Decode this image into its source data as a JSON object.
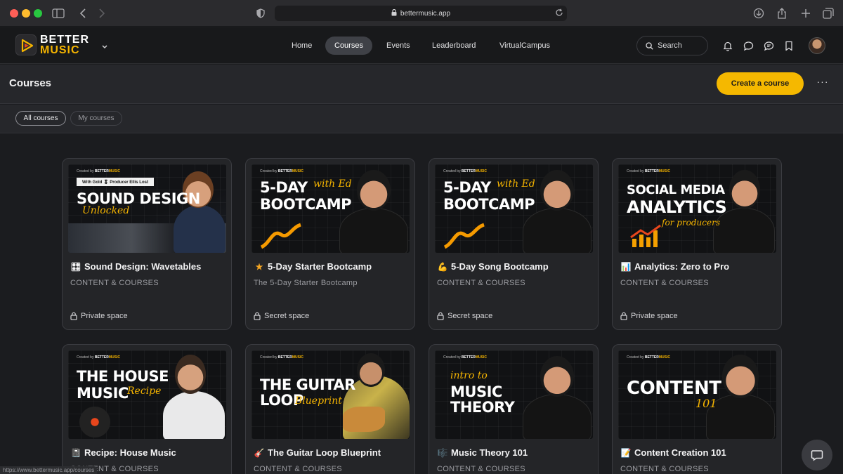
{
  "browser": {
    "url": "bettermusic.app",
    "status_url": "https://www.bettermusic.app/courses"
  },
  "brand": {
    "line1": "BETTER",
    "line2": "MUSIC"
  },
  "nav": {
    "items": [
      "Home",
      "Courses",
      "Events",
      "Leaderboard",
      "VirtualCampus"
    ],
    "active": "Courses"
  },
  "search": {
    "label": "Search"
  },
  "page": {
    "title": "Courses",
    "create_label": "Create a course",
    "more_label": "···"
  },
  "filters": {
    "all": "All courses",
    "mine": "My courses"
  },
  "thumb_brand": {
    "prefix": "Created by",
    "name1": "BETTER",
    "name2": "MUSIC"
  },
  "courses": [
    {
      "title": "Sound Design: Wavetables",
      "icon": "wave-emoji-icon",
      "glyph": "🎛",
      "subtitle": "CONTENT & COURSES",
      "space": "Private space",
      "thumb": {
        "banner": "With Gold 🎖 Producer Ellis Lost",
        "line1": "SOUND DESIGN",
        "script": "Unlocked"
      }
    },
    {
      "title": "5-Day Starter Bootcamp",
      "icon": "star-icon",
      "glyph": "★",
      "subtitle": "The 5-Day Starter Bootcamp",
      "space": "Secret space",
      "thumb": {
        "line1": "5-DAY",
        "script": "with Ed",
        "line2": "BOOTCAMP"
      }
    },
    {
      "title": "5-Day Song Bootcamp",
      "icon": "muscle-icon",
      "glyph": "💪",
      "subtitle": "CONTENT & COURSES",
      "space": "Secret space",
      "thumb": {
        "line1": "5-DAY",
        "script": "with Ed",
        "line2": "BOOTCAMP"
      }
    },
    {
      "title": "Analytics: Zero to Pro",
      "icon": "chart-icon",
      "glyph": "📊",
      "subtitle": "CONTENT & COURSES",
      "space": "Private space",
      "thumb": {
        "line1": "SOCIAL MEDIA",
        "line2": "ANALYTICS",
        "script": "for producers"
      }
    },
    {
      "title": "Recipe: House Music",
      "icon": "recipe-icon",
      "glyph": "📓",
      "subtitle": "CONTENT & COURSES",
      "space": "",
      "thumb": {
        "line1": "THE HOUSE",
        "line2": "MUSIC",
        "script": "Recipe"
      }
    },
    {
      "title": "The Guitar Loop Blueprint",
      "icon": "guitar-icon",
      "glyph": "🎸",
      "subtitle": "CONTENT & COURSES",
      "space": "",
      "thumb": {
        "line1": "THE GUITAR",
        "line2": "LOOP",
        "script": "Blueprint"
      }
    },
    {
      "title": "Music Theory 101",
      "icon": "sheet-music-icon",
      "glyph": "🎼",
      "subtitle": "CONTENT & COURSES",
      "space": "",
      "thumb": {
        "script": "intro to",
        "line1": "MUSIC",
        "line2": "THEORY"
      }
    },
    {
      "title": "Content Creation 101",
      "icon": "notepad-icon",
      "glyph": "📝",
      "subtitle": "CONTENT & COURSES",
      "space": "",
      "thumb": {
        "line1": "CONTENT",
        "script": "101"
      }
    }
  ],
  "colors": {
    "accent": "#f5b800",
    "background": "#1b1c1f",
    "card": "#242528"
  }
}
